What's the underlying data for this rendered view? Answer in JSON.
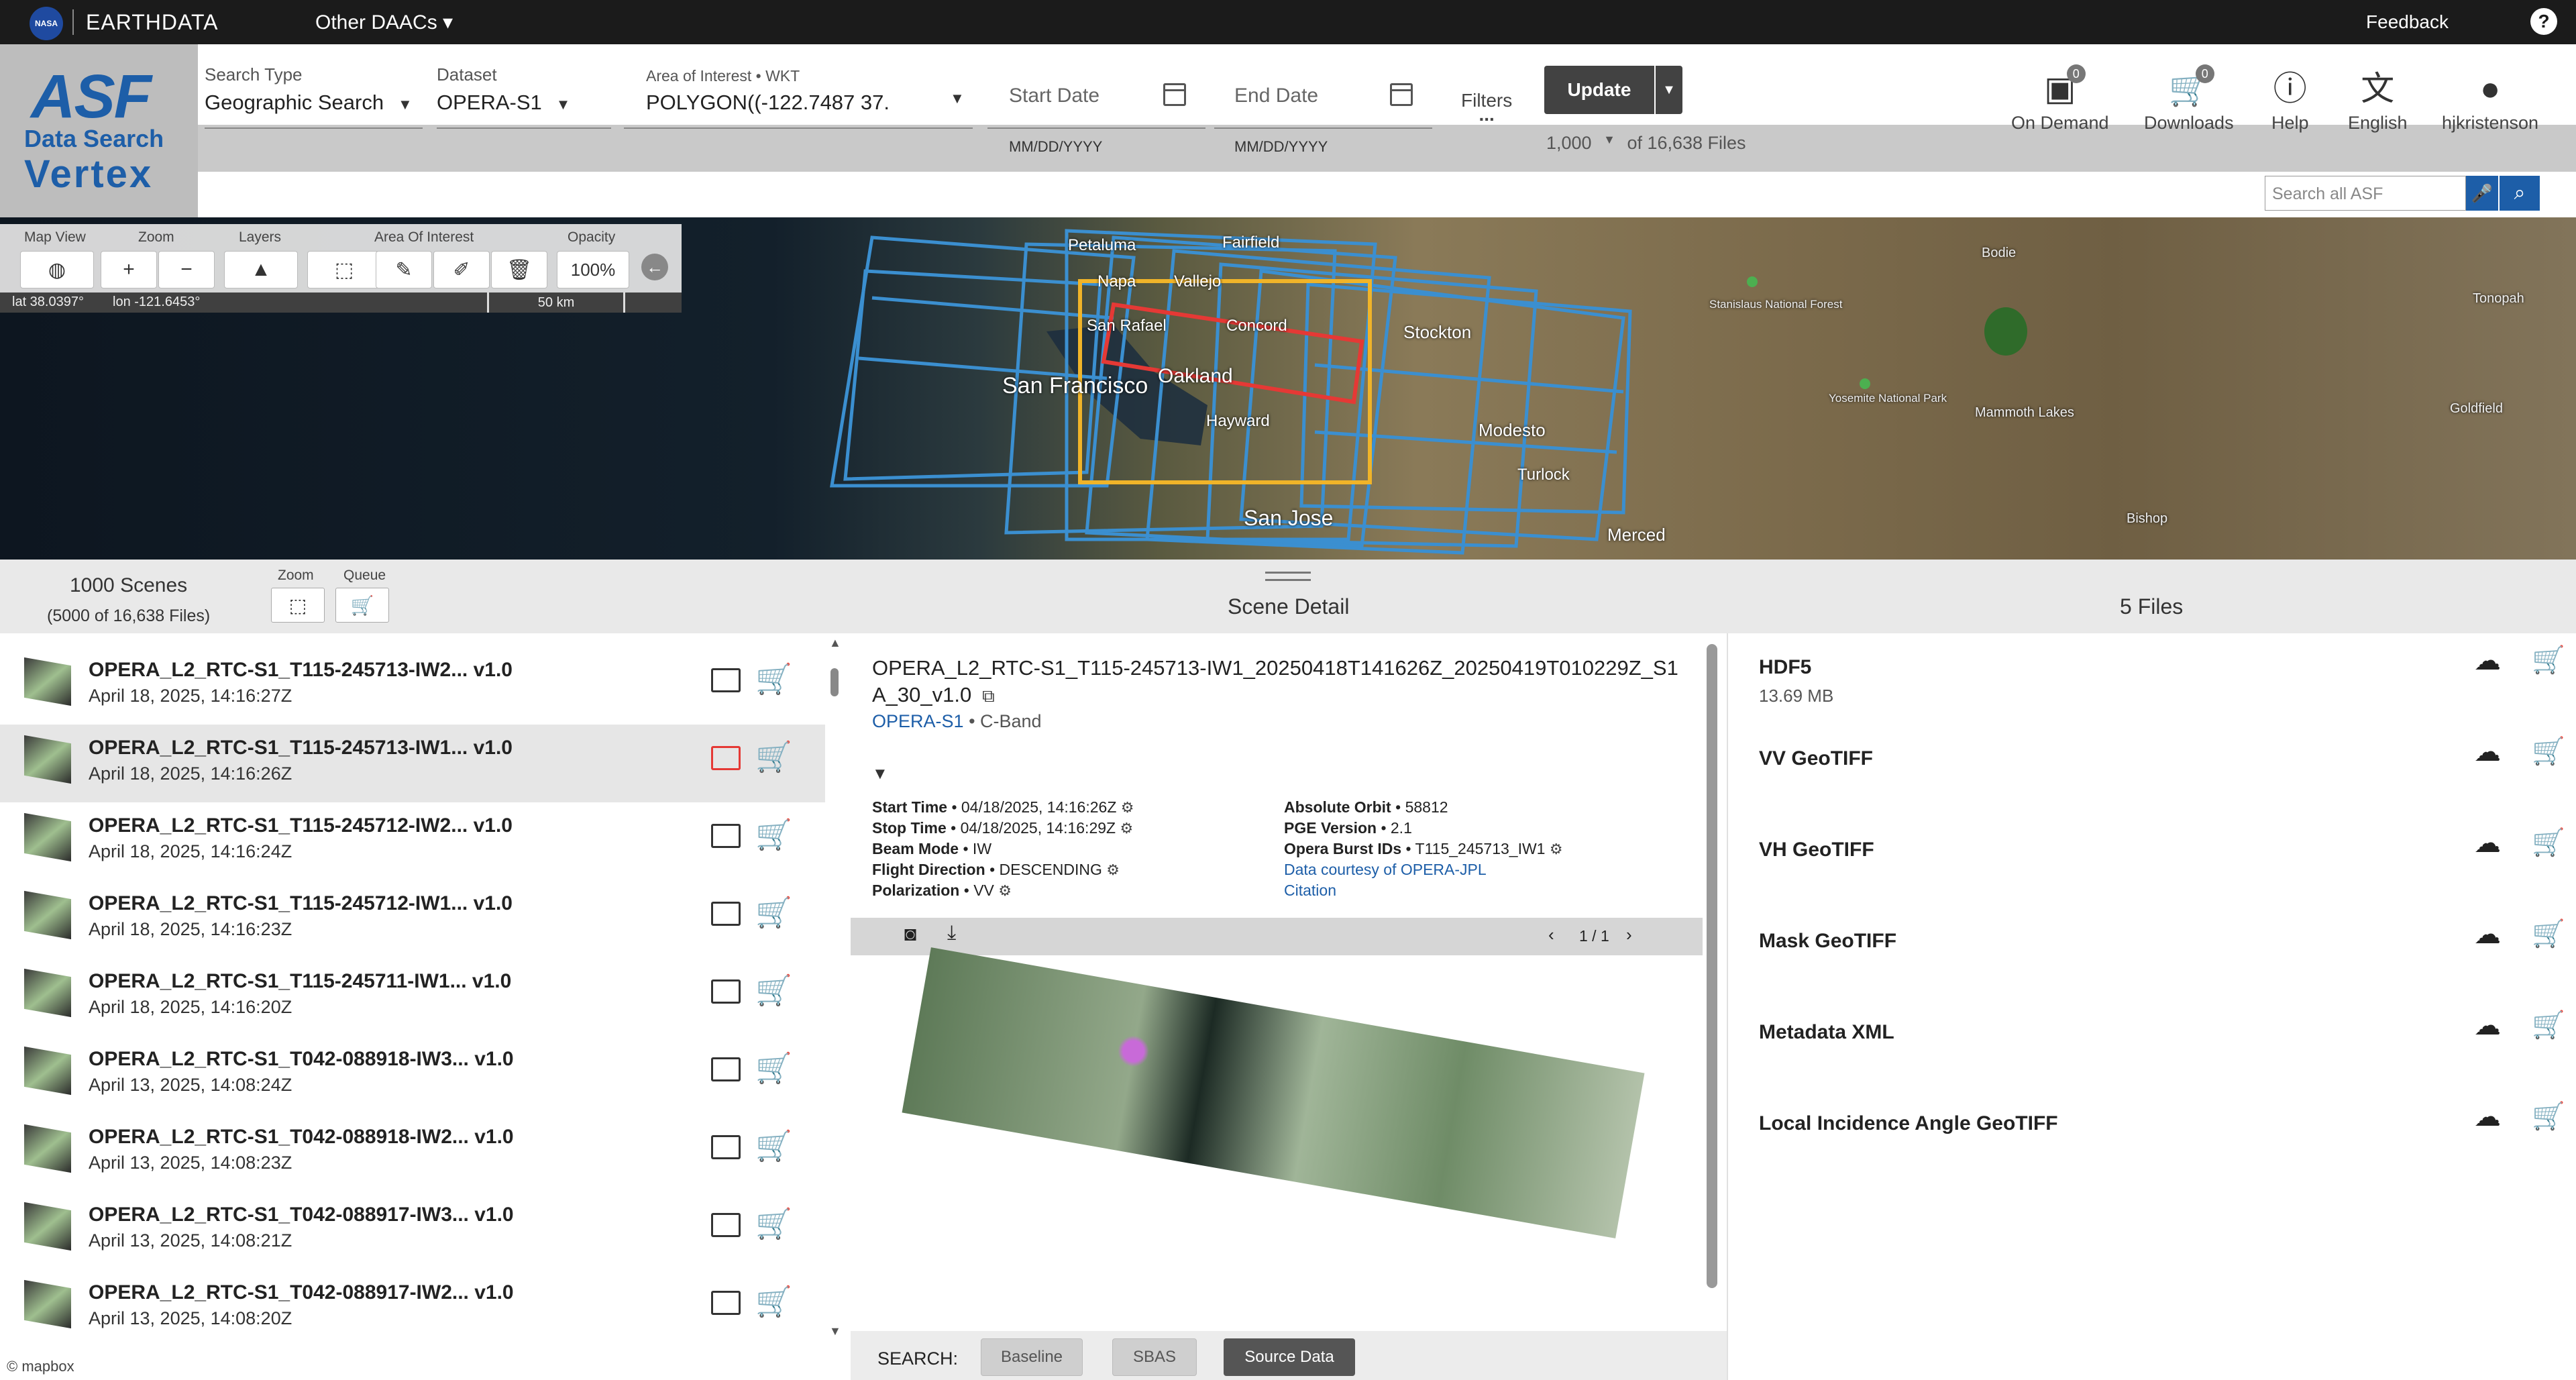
{
  "topbar": {
    "logo_text": "NASA",
    "earthdata": "EARTHDATA",
    "daacs": "Other DAACs ▾",
    "feedback": "Feedback",
    "help": "?"
  },
  "logo": {
    "asf": "ASF",
    "data_search": "Data Search",
    "vertex": "Vertex"
  },
  "header": {
    "search_type_label": "Search Type",
    "search_type_value": "Geographic Search",
    "dataset_label": "Dataset",
    "dataset_value": "OPERA-S1",
    "aoi_label": "Area of Interest • WKT",
    "aoi_value": "POLYGON((-122.7487 37.",
    "start_date_placeholder": "Start Date",
    "start_date_format": "MM/DD/YYYY",
    "end_date_placeholder": "End Date",
    "end_date_format": "MM/DD/YYYY",
    "filters_label": "Filters",
    "filters_dots": "...",
    "update_label": "Update",
    "max_results": "1,000",
    "files_total": "of 16,638 Files",
    "on_demand_label": "On Demand",
    "on_demand_count": "0",
    "downloads_label": "Downloads",
    "downloads_count": "0",
    "help_label": "Help",
    "language_label": "English",
    "user_label": "hjkristenson",
    "search_all_placeholder": "Search all ASF"
  },
  "map": {
    "map_view_label": "Map View",
    "zoom_label": "Zoom",
    "layers_label": "Layers",
    "aoi_label": "Area Of Interest",
    "opacity_label": "Opacity",
    "opacity_value": "100%",
    "lat": "lat 38.0397°",
    "lon": "lon -121.6453°",
    "scale": "50 km",
    "cities": {
      "petaluma": "Petaluma",
      "fairfield": "Fairfield",
      "vallejo": "Vallejo",
      "napa": "Napa",
      "san_rafael": "San Rafael",
      "concord": "Concord",
      "oakland": "Oakland",
      "san_francisco": "San Francisco",
      "hayward": "Hayward",
      "stockton": "Stockton",
      "modesto": "Modesto",
      "turlock": "Turlock",
      "san_jose": "San Jose",
      "merced": "Merced",
      "bodie": "Bodie",
      "tonopah": "Tonopah",
      "goldfield": "Goldfield",
      "mammoth": "Mammoth\nLakes",
      "bishop": "Bishop",
      "stanislaus": "Stanislaus\nNational Forest",
      "yosemite": "Yosemite\nNational Park"
    },
    "mapbox": "© mapbox"
  },
  "results": {
    "scenes_count": "1000 Scenes",
    "files_count": "(5000 of 16,638 Files)",
    "zoom_label": "Zoom",
    "queue_label": "Queue",
    "detail_title": "Scene Detail",
    "files_title": "5 Files"
  },
  "scenes": [
    {
      "name": "OPERA_L2_RTC-S1_T115-245713-IW2... v1.0",
      "date": "April 18, 2025, 14:16:27Z"
    },
    {
      "name": "OPERA_L2_RTC-S1_T115-245713-IW1... v1.0",
      "date": "April 18, 2025, 14:16:26Z"
    },
    {
      "name": "OPERA_L2_RTC-S1_T115-245712-IW2... v1.0",
      "date": "April 18, 2025, 14:16:24Z"
    },
    {
      "name": "OPERA_L2_RTC-S1_T115-245712-IW1... v1.0",
      "date": "April 18, 2025, 14:16:23Z"
    },
    {
      "name": "OPERA_L2_RTC-S1_T115-245711-IW1... v1.0",
      "date": "April 18, 2025, 14:16:20Z"
    },
    {
      "name": "OPERA_L2_RTC-S1_T042-088918-IW3... v1.0",
      "date": "April 13, 2025, 14:08:24Z"
    },
    {
      "name": "OPERA_L2_RTC-S1_T042-088918-IW2... v1.0",
      "date": "April 13, 2025, 14:08:23Z"
    },
    {
      "name": "OPERA_L2_RTC-S1_T042-088917-IW3... v1.0",
      "date": "April 13, 2025, 14:08:21Z"
    },
    {
      "name": "OPERA_L2_RTC-S1_T042-088917-IW2... v1.0",
      "date": "April 13, 2025, 14:08:20Z"
    }
  ],
  "detail": {
    "title": "OPERA_L2_RTC-S1_T115-245713-IW1_20250418T141626Z_20250419T010229Z_S1A_30_v1.0",
    "dataset": "OPERA-S1",
    "band": "• C-Band",
    "start_time_label": "Start Time",
    "start_time": "• 04/18/2025, 14:16:26Z",
    "stop_time_label": "Stop Time",
    "stop_time": "• 04/18/2025, 14:16:29Z",
    "beam_mode_label": "Beam Mode",
    "beam_mode": "• IW",
    "flight_dir_label": "Flight Direction",
    "flight_dir": "• DESCENDING",
    "polarization_label": "Polarization",
    "polarization": "• VV",
    "abs_orbit_label": "Absolute Orbit",
    "abs_orbit": "• 58812",
    "pge_label": "PGE Version",
    "pge": "• 2.1",
    "burst_label": "Opera Burst IDs",
    "burst": "• T115_245713_IW1",
    "courtesy": "Data courtesy of OPERA-JPL",
    "citation": "Citation",
    "pager": "1 / 1",
    "search_label": "SEARCH:",
    "baseline": "Baseline",
    "sbas": "SBAS",
    "source_data": "Source Data"
  },
  "files": [
    {
      "name": "HDF5",
      "size": "13.69 MB"
    },
    {
      "name": "VV GeoTIFF",
      "size": ""
    },
    {
      "name": "VH GeoTIFF",
      "size": ""
    },
    {
      "name": "Mask GeoTIFF",
      "size": ""
    },
    {
      "name": "Metadata XML",
      "size": ""
    },
    {
      "name": "Local Incidence Angle GeoTIFF",
      "size": ""
    }
  ],
  "colors": {
    "accent": "#1d5ea8",
    "aoi_outline": "#f0b429",
    "selected_scene": "#e53935",
    "footprint": "#3b8fd0"
  }
}
